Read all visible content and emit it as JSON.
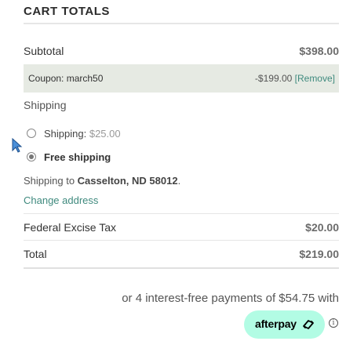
{
  "cart": {
    "title": "CART TOTALS",
    "subtotal_label": "Subtotal",
    "subtotal_value": "$398.00",
    "coupon_label": "Coupon: march50",
    "coupon_amount": "-$199.00",
    "coupon_remove": "[Remove]",
    "shipping_heading": "Shipping",
    "options": [
      {
        "label": "Shipping:",
        "price": "$25.00",
        "selected": false
      },
      {
        "label": "Free shipping",
        "price": "",
        "selected": true
      }
    ],
    "ship_to_prefix": "Shipping to ",
    "ship_to_address": "Casselton, ND 58012",
    "ship_to_suffix": ".",
    "change_address": "Change address",
    "tax_label": "Federal Excise Tax",
    "tax_value": "$20.00",
    "total_label": "Total",
    "total_value": "$219.00"
  },
  "afterpay": {
    "text": "or 4 interest-free payments of $54.75 with",
    "brand": "afterpay",
    "info": "i"
  },
  "colors": {
    "accent": "#3f8a7e",
    "coupon_bg": "#e6eae3",
    "afterpay_mint": "#b2fce4"
  },
  "icons": [
    "mouse-cursor-icon",
    "afterpay-arrows-icon",
    "info-icon"
  ]
}
